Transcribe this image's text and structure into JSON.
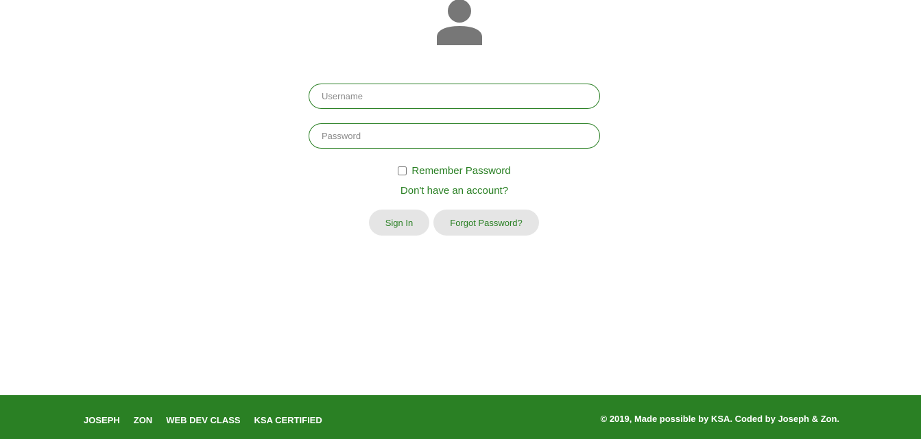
{
  "avatar": {
    "icon": "user-icon",
    "color": "#777777"
  },
  "login_form": {
    "username": {
      "value": "",
      "placeholder": "Username"
    },
    "password": {
      "value": "",
      "placeholder": "Password"
    },
    "remember_label": "Remember Password",
    "remember_checked": false,
    "signup_link": "Don't have an account?",
    "signin_label": "Sign In",
    "forgot_label": "Forgot Password?"
  },
  "footer": {
    "links": [
      "JOSEPH",
      "ZON",
      "WEB DEV CLASS",
      "KSA CERTIFIED"
    ],
    "copyright": "© 2019, Made possible by KSA. Coded by Joseph & Zon."
  },
  "colors": {
    "accent": "#2a8024",
    "button_bg": "#e5e5e5",
    "footer_bg": "#2a8024"
  }
}
